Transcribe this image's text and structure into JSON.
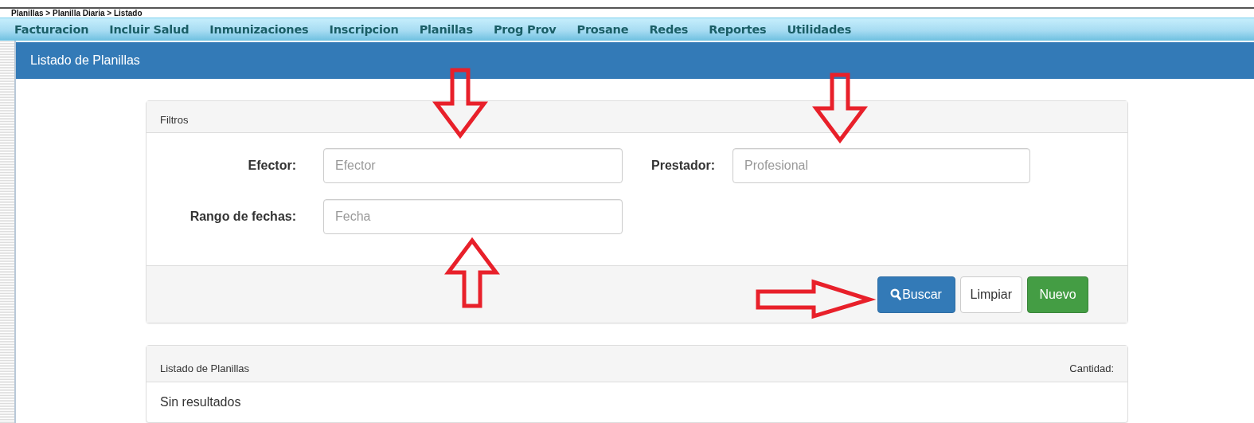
{
  "breadcrumb": "Planillas > Planilla Diaria > Listado",
  "menu": [
    {
      "label": "Facturacion"
    },
    {
      "label": "Incluir Salud"
    },
    {
      "label": "Inmunizaciones"
    },
    {
      "label": "Inscripcion"
    },
    {
      "label": "Planillas"
    },
    {
      "label": "Prog Prov"
    },
    {
      "label": "Prosane"
    },
    {
      "label": "Redes"
    },
    {
      "label": "Reportes"
    },
    {
      "label": "Utilidades"
    }
  ],
  "page_title": "Listado de Planillas",
  "filters": {
    "title": "Filtros",
    "fields": [
      {
        "label": "Efector:",
        "placeholder": "Efector"
      },
      {
        "label": "Prestador:",
        "placeholder": "Profesional"
      },
      {
        "label": "Rango de fechas:",
        "placeholder": "Fecha"
      }
    ],
    "buttons": [
      {
        "kind": "primary",
        "label": "Buscar"
      },
      {
        "kind": "default",
        "label": "Limpiar"
      },
      {
        "kind": "success",
        "label": "Nuevo"
      }
    ]
  },
  "results": {
    "title": "Listado de Planillas",
    "count_label": "Cantidad:",
    "empty_text": "Sin resultados"
  }
}
